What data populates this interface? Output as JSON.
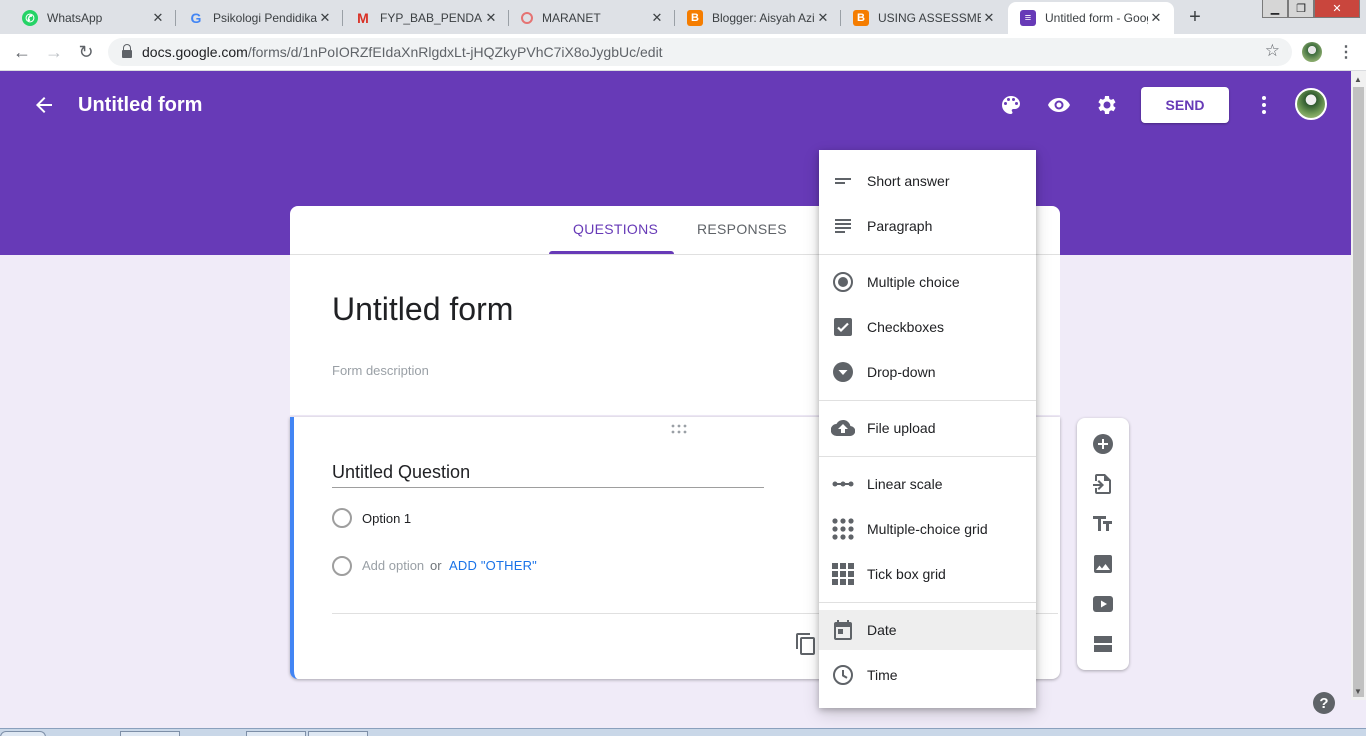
{
  "browser": {
    "tabs": [
      {
        "label": "WhatsApp",
        "icon": "whatsapp-icon"
      },
      {
        "label": "Psikologi Pendidikan",
        "icon": "google-icon"
      },
      {
        "label": "FYP_BAB_PENDAHULUAN",
        "icon": "gmail-icon"
      },
      {
        "label": "MARANET",
        "icon": "maranet-icon"
      },
      {
        "label": "Blogger: Aisyah Aziz",
        "icon": "blogger-icon"
      },
      {
        "label": "USING ASSESSMENT",
        "icon": "blogger-icon"
      },
      {
        "label": "Untitled form - Google Forms",
        "icon": "forms-icon"
      }
    ],
    "url_host": "docs.google.com",
    "url_path": "/forms/d/1nPoIORZfEIdaXnRlgdxLt-jHQZkyPVhC7iX8oJygbUc/edit"
  },
  "header": {
    "title": "Untitled form",
    "send_label": "SEND",
    "color": "#673ab7"
  },
  "form_tabs": {
    "questions": "QUESTIONS",
    "responses": "RESPONSES"
  },
  "form": {
    "title": "Untitled form",
    "description_placeholder": "Form description"
  },
  "question": {
    "title": "Untitled Question",
    "option1": "Option 1",
    "add_option": "Add option",
    "or": "or",
    "add_other": "ADD \"OTHER\""
  },
  "type_menu": {
    "items": [
      {
        "label": "Short answer",
        "icon": "short-answer-icon"
      },
      {
        "label": "Paragraph",
        "icon": "paragraph-icon"
      },
      {
        "label": "Multiple choice",
        "icon": "radio-icon"
      },
      {
        "label": "Checkboxes",
        "icon": "checkbox-icon"
      },
      {
        "label": "Drop-down",
        "icon": "dropdown-icon"
      },
      {
        "label": "File upload",
        "icon": "cloud-upload-icon"
      },
      {
        "label": "Linear scale",
        "icon": "linear-scale-icon"
      },
      {
        "label": "Multiple-choice grid",
        "icon": "dot-grid-icon"
      },
      {
        "label": "Tick box grid",
        "icon": "square-grid-icon"
      },
      {
        "label": "Date",
        "icon": "calendar-icon"
      },
      {
        "label": "Time",
        "icon": "clock-icon"
      }
    ],
    "highlighted": "Date"
  },
  "help_label": "?"
}
